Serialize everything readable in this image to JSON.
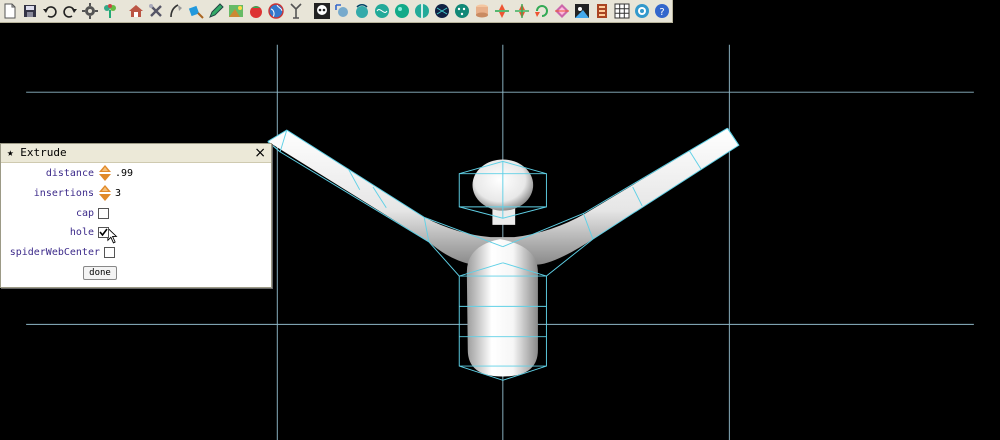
{
  "toolbar": {
    "icons": [
      "new-file-icon",
      "save-icon",
      "undo-icon",
      "redo-icon",
      "gear-icon",
      "plant-icon",
      "house-icon",
      "tools-icon",
      "lamp-icon",
      "paint-brush-icon",
      "pencil-icon",
      "image-icon",
      "tomato-icon",
      "globe-icon",
      "figure-icon",
      "skull-icon",
      "sphere-move-icon",
      "sphere-grab-icon",
      "sphere-twist-icon",
      "sphere-teal-icon",
      "sphere-cut-icon",
      "sphere-dark-icon",
      "sphere-dots-icon",
      "cylinder-icon",
      "spinner-red-icon",
      "spinner-cross-icon",
      "spinner-arc-icon",
      "diamond-icon",
      "picture-icon",
      "film-strip-icon",
      "grid-icon",
      "wheel-icon",
      "help-icon"
    ]
  },
  "panel": {
    "title": "Extrude",
    "title_star": "★",
    "close": "×",
    "distance": {
      "label": "distance",
      "value": ".99"
    },
    "insertions": {
      "label": "insertions",
      "value": "3"
    },
    "cap": {
      "label": "cap",
      "checked": false
    },
    "hole": {
      "label": "hole",
      "checked": true
    },
    "spiderWebCenter": {
      "label": "spiderWebCenter",
      "checked": false
    },
    "done": "done"
  },
  "colors": {
    "wire": "#5fd0e6",
    "grid": "#8fb8c8",
    "background": "#000000",
    "panel_label": "#3c2a8a"
  }
}
